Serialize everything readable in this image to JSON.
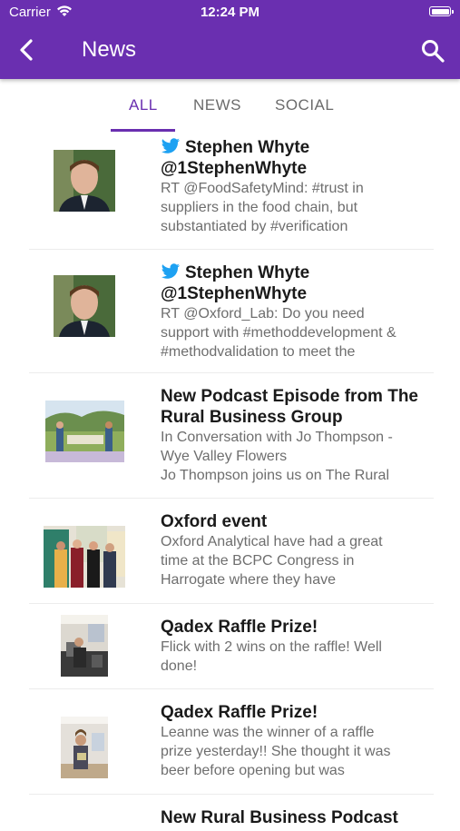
{
  "status_bar": {
    "carrier": "Carrier",
    "time": "12:24 PM"
  },
  "header": {
    "title": "News"
  },
  "tabs": [
    {
      "label": "ALL",
      "active": true
    },
    {
      "label": "NEWS",
      "active": false
    },
    {
      "label": "SOCIAL",
      "active": false
    }
  ],
  "colors": {
    "accent": "#6a2fb0",
    "twitter": "#1da1f2"
  },
  "items": [
    {
      "source": "twitter",
      "title": "Stephen Whyte\n@1StephenWhyte",
      "body": "RT @FoodSafetyMind: #trust in\nsuppliers in the food chain, but\nsubstantiated by #verification"
    },
    {
      "source": "twitter",
      "title": "Stephen Whyte\n@1StephenWhyte",
      "body": "RT @Oxford_Lab: Do you need\nsupport with #methoddevelopment &\n#methodvalidation to meet the"
    },
    {
      "source": "news",
      "title": "New Podcast Episode from The\nRural Business Group",
      "body": "In Conversation with Jo Thompson -\nWye Valley Flowers\nJo Thompson joins us on The Rural"
    },
    {
      "source": "news",
      "title": "Oxford event",
      "body": "Oxford Analytical have had a great\ntime at the BCPC Congress in\nHarrogate where they have"
    },
    {
      "source": "news",
      "title": "Qadex Raffle Prize!",
      "body": "Flick with 2 wins on the raffle! Well\ndone!"
    },
    {
      "source": "news",
      "title": "Qadex Raffle Prize!",
      "body": "Leanne was the winner of a raffle\nprize yesterday!! She thought it was\nbeer before opening but was"
    },
    {
      "source": "news",
      "title": "New Rural Business Podcast",
      "body": ""
    }
  ]
}
